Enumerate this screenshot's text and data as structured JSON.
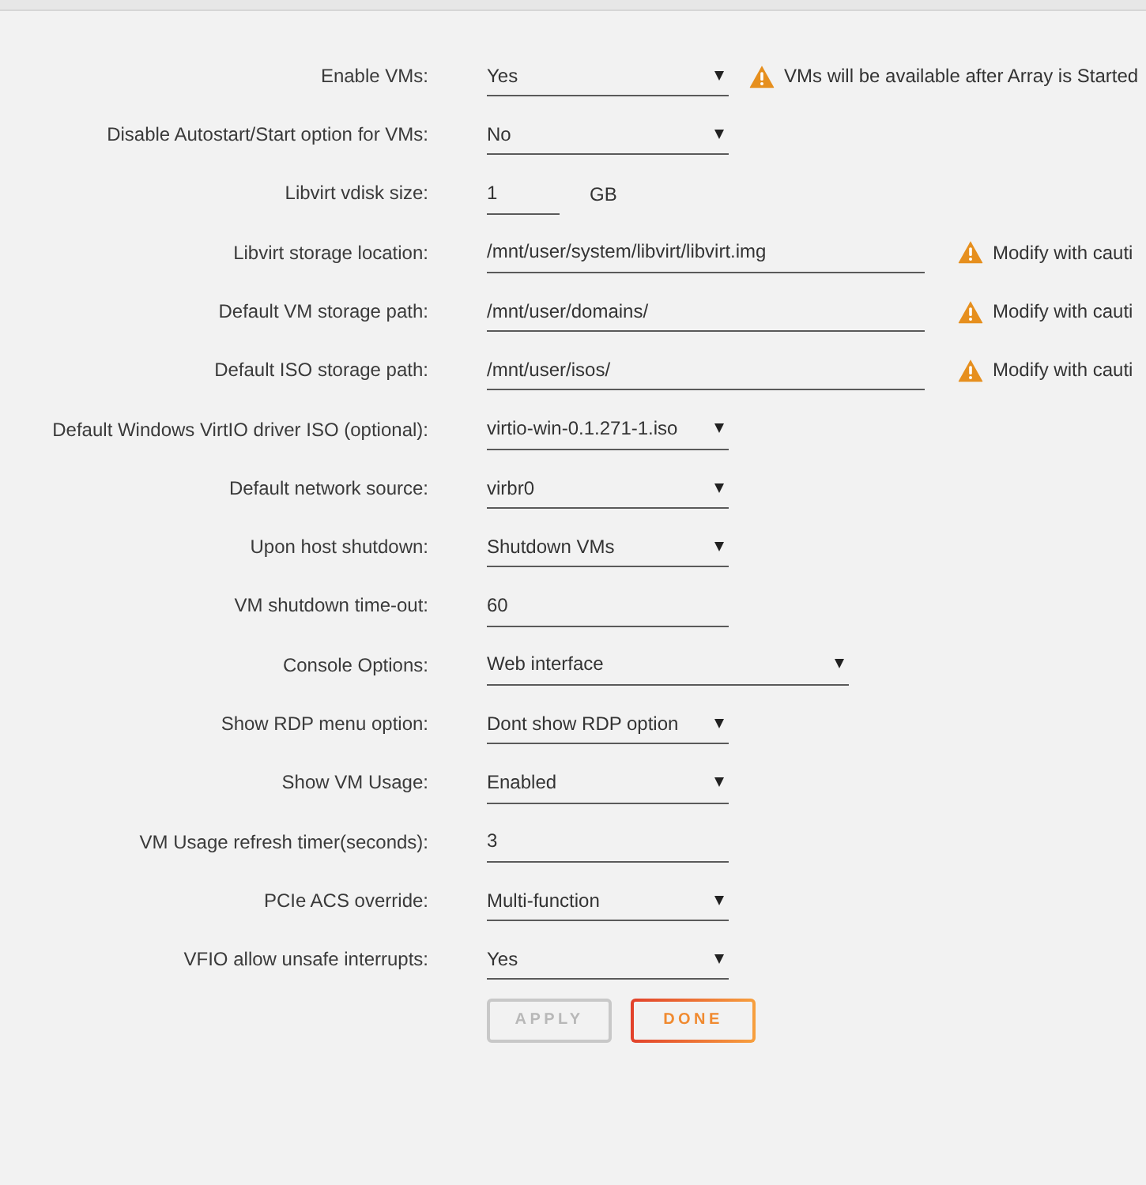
{
  "settings": [
    {
      "label": "Enable VMs:",
      "kind": "select",
      "value": "Yes",
      "warning": "VMs will be available after Array is Started"
    },
    {
      "label": "Disable Autostart/Start option for VMs:",
      "kind": "select",
      "value": "No"
    },
    {
      "label": "Libvirt vdisk size:",
      "kind": "number",
      "value": "1",
      "unit": "GB"
    },
    {
      "label": "Libvirt storage location:",
      "kind": "text",
      "value": "/mnt/user/system/libvirt/libvirt.img",
      "warning": "Modify with cauti"
    },
    {
      "label": "Default VM storage path:",
      "kind": "text",
      "value": "/mnt/user/domains/",
      "warning": "Modify with cauti"
    },
    {
      "label": "Default ISO storage path:",
      "kind": "text",
      "value": "/mnt/user/isos/",
      "warning": "Modify with cauti"
    },
    {
      "label": "Default Windows VirtIO driver ISO (optional):",
      "kind": "select",
      "value": "virtio-win-0.1.271-1.iso"
    },
    {
      "label": "Default network source:",
      "kind": "select",
      "value": "virbr0"
    },
    {
      "label": "Upon host shutdown:",
      "kind": "select",
      "value": "Shutdown VMs"
    },
    {
      "label": "VM shutdown time-out:",
      "kind": "text",
      "value": "60"
    },
    {
      "label": "Console Options:",
      "kind": "select",
      "value": "Web interface"
    },
    {
      "label": "Show RDP menu option:",
      "kind": "select",
      "value": "Dont show RDP option"
    },
    {
      "label": "Show VM Usage:",
      "kind": "select",
      "value": "Enabled"
    },
    {
      "label": "VM Usage refresh timer(seconds):",
      "kind": "text",
      "value": "3"
    },
    {
      "label": "PCIe ACS override:",
      "kind": "select",
      "value": "Multi-function"
    },
    {
      "label": "VFIO allow unsafe interrupts:",
      "kind": "select",
      "value": "Yes"
    }
  ],
  "buttons": [
    {
      "label": "APPLY",
      "disabled": true
    },
    {
      "label": "DONE",
      "disabled": false
    }
  ]
}
